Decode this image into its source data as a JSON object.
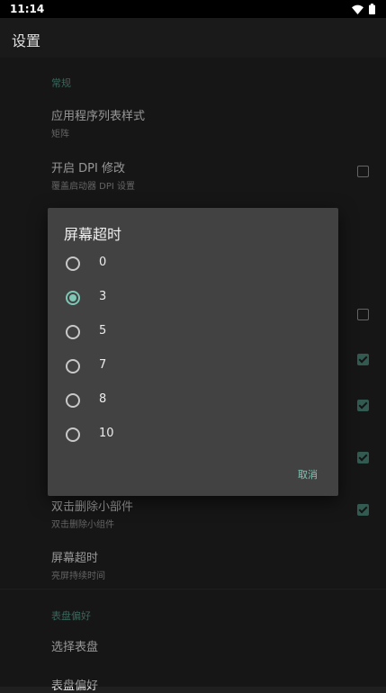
{
  "status_bar": {
    "time": "11:14"
  },
  "app_bar": {
    "title": "设置"
  },
  "sections": {
    "general_header": "常规",
    "watch_pref_header": "表盘偏好"
  },
  "prefs": {
    "list_style": {
      "title": "应用程序列表样式",
      "summary": "矩阵"
    },
    "dpi": {
      "title": "开启 DPI 修改",
      "summary": "覆盖启动器 DPI 设置",
      "checked": false
    },
    "double_click_delete": {
      "title": "双击删除小部件",
      "summary": "双击删除小组件",
      "checked": true
    },
    "screen_timeout": {
      "title": "屏幕超时",
      "summary": "亮屏持续时间"
    },
    "choose_watchface": {
      "title": "选择表盘"
    },
    "watchface_pref": {
      "title": "表盘偏好"
    }
  },
  "hidden_checkboxes": [
    false,
    true,
    true,
    true
  ],
  "dialog": {
    "title": "屏幕超时",
    "options": [
      "0",
      "3",
      "5",
      "7",
      "8",
      "10"
    ],
    "selected": "3",
    "cancel_label": "取消"
  },
  "colors": {
    "accent": "#7ec6b5",
    "checkbox_checked": "#4e8a7c",
    "section_header": "#5a9b8a"
  }
}
